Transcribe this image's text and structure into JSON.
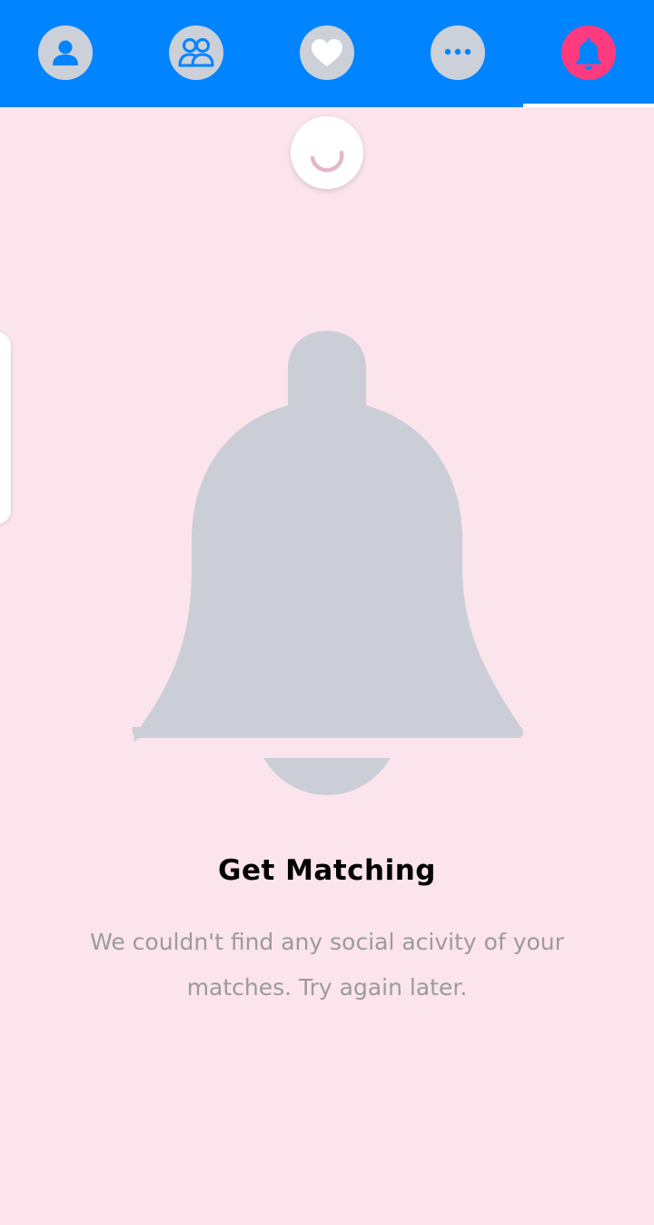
{
  "colors": {
    "topbar": "#0084ff",
    "background": "#fbe4ec",
    "inactive_icon_bg": "#ccd0d9",
    "active_icon_bg": "#ff3b7f",
    "icon_fg": "#0084ff",
    "title": "#000000",
    "message": "#9b9b9b"
  },
  "tabs": [
    {
      "icon": "profile-icon",
      "active": false
    },
    {
      "icon": "group-icon",
      "active": false
    },
    {
      "icon": "heart-icon",
      "active": false
    },
    {
      "icon": "chat-icon",
      "active": false
    },
    {
      "icon": "bell-icon",
      "active": true
    }
  ],
  "loading_indicator": {
    "icon": "spinner-icon"
  },
  "empty_state": {
    "icon": "bell-icon",
    "title": "Get Matching",
    "message": "We couldn't find any social acivity of your matches. Try again later."
  }
}
